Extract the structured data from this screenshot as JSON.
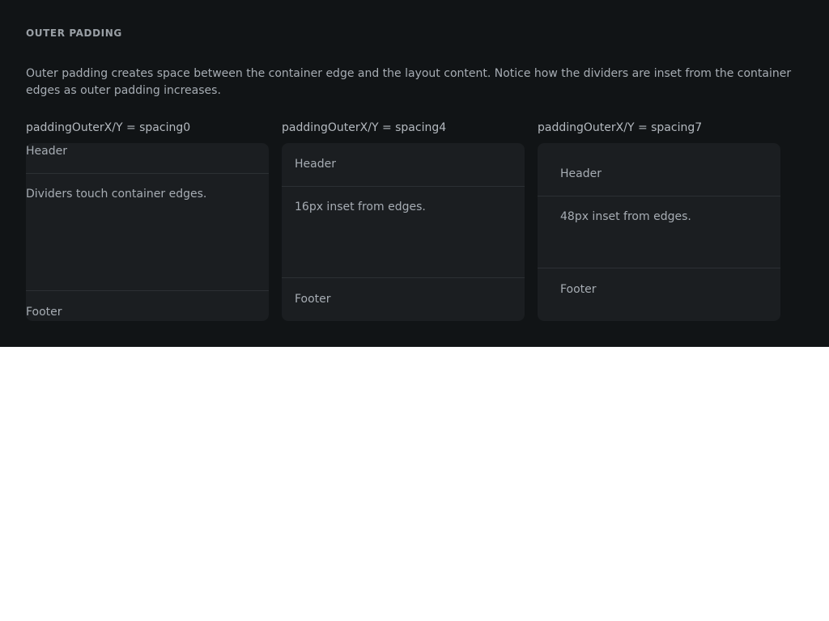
{
  "section": {
    "title": "OUTER PADDING",
    "description": "Outer padding creates space between the container edge and the layout content. Notice how the dividers are inset from the container edges as outer padding increases."
  },
  "demos": [
    {
      "label": "paddingOuterX/Y = spacing0",
      "header": "Header",
      "body": "Dividers touch container edges.",
      "footer": "Footer"
    },
    {
      "label": "paddingOuterX/Y = spacing4",
      "header": "Header",
      "body": "16px inset from edges.",
      "footer": "Footer"
    },
    {
      "label": "paddingOuterX/Y = spacing7",
      "header": "Header",
      "body": "48px inset from edges.",
      "footer": "Footer"
    }
  ],
  "colors": {
    "background": "#111416",
    "card": "#1b1e21",
    "divider": "#2c3034",
    "text": "#a7adb4"
  }
}
